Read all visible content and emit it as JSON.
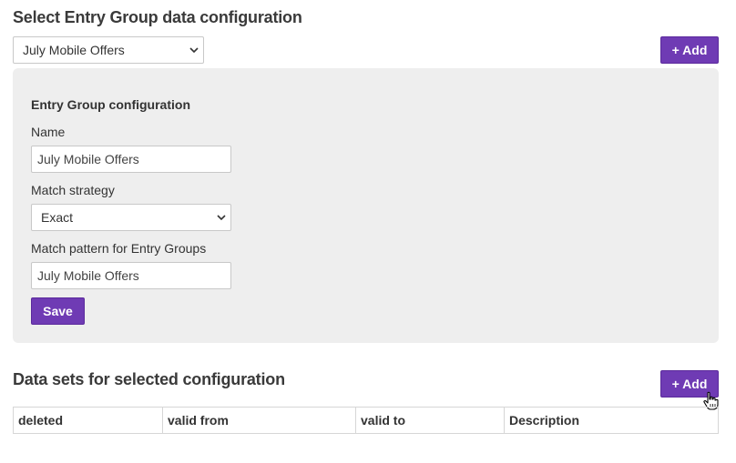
{
  "top": {
    "title": "Select Entry Group data configuration",
    "selected_configuration": "July Mobile Offers",
    "add_label": "+ Add"
  },
  "config_panel": {
    "heading": "Entry Group configuration",
    "name_label": "Name",
    "name_value": "July Mobile Offers",
    "match_strategy_label": "Match strategy",
    "match_strategy_value": "Exact",
    "match_pattern_label": "Match pattern for Entry Groups",
    "match_pattern_value": "July Mobile Offers",
    "save_label": "Save"
  },
  "datasets": {
    "title": "Data sets for selected configuration",
    "add_label": "+ Add",
    "columns": [
      "deleted",
      "valid from",
      "valid to",
      "Description"
    ]
  },
  "icons": {
    "select_arrow": "chevron-down-icon",
    "cursor": "hand-pointer-icon"
  },
  "colors": {
    "accent": "#6f3bb4",
    "panel_bg": "#eeeeee",
    "border": "#c8c8c8"
  }
}
